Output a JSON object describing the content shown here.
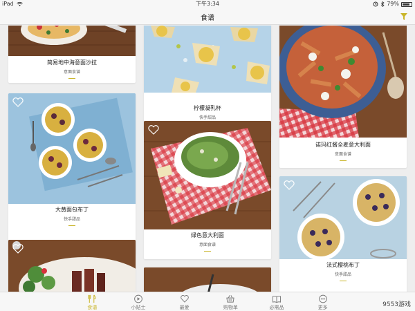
{
  "status": {
    "device": "iPad",
    "time": "下午3:34",
    "battery": "79%"
  },
  "nav": {
    "title": "食谱"
  },
  "cards": [
    {
      "name": "简易地中海意面沙拉",
      "category": "意面食谱"
    },
    {
      "name": "柠檬凝乳杯",
      "category": "快手甜品"
    },
    {
      "name": "诺玛红酱全麦意大利面",
      "category": "意面食谱"
    },
    {
      "name": "大黄面包布丁",
      "category": "快手甜品"
    },
    {
      "name": "绿色意大利面",
      "category": "意面食谱"
    },
    {
      "name": "法式樱桃布丁",
      "category": "快手甜品"
    }
  ],
  "tabs": [
    {
      "label": "食谱",
      "icon": "cutlery-icon",
      "active": true
    },
    {
      "label": "小贴士",
      "icon": "play-circle-icon"
    },
    {
      "label": "最爱",
      "icon": "heart-icon"
    },
    {
      "label": "购物单",
      "icon": "basket-icon"
    },
    {
      "label": "必需品",
      "icon": "book-icon"
    },
    {
      "label": "更多",
      "icon": "more-icon"
    }
  ],
  "watermark": "9553游戏",
  "colors": {
    "accent": "#c9b52a",
    "wood": "#7a4a2a",
    "blue": "#8fb8d6",
    "gingham": "#d8323c"
  }
}
